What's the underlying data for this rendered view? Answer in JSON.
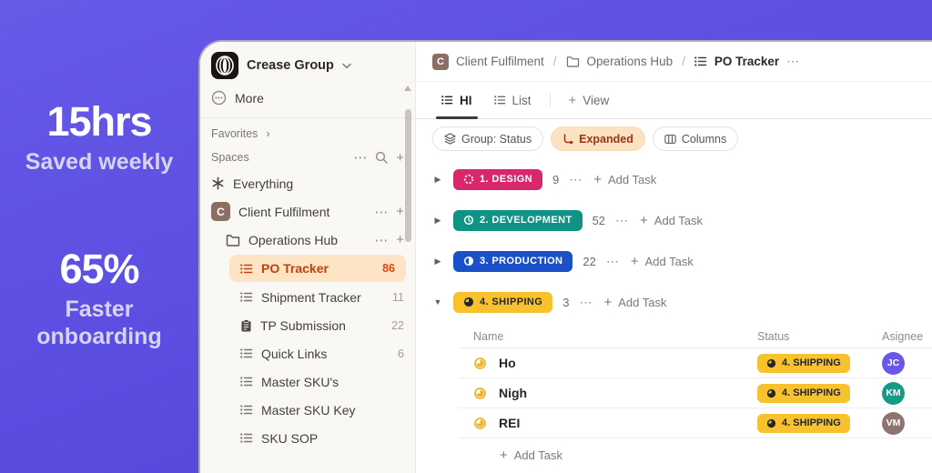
{
  "stats": [
    {
      "value": "15hrs",
      "label": "Saved weekly"
    },
    {
      "value": "65%",
      "label": "Faster onboarding"
    }
  ],
  "icons": {
    "ellipsis": "⋯",
    "plus": "+",
    "chevron_right": "›",
    "tri_right": "▶",
    "tri_down": "▼"
  },
  "sidebar": {
    "workspace_name": "Crease Group",
    "more_label": "More",
    "favorites_label": "Favorites",
    "spaces_label": "Spaces",
    "items": [
      {
        "label": "Everything"
      },
      {
        "label": "Client Fulfilment",
        "avatar_letter": "C",
        "avatar_color": "#8d6e63"
      },
      {
        "label": "Operations Hub"
      },
      {
        "label": "PO Tracker",
        "count": "86"
      },
      {
        "label": "Shipment Tracker",
        "count": "11"
      },
      {
        "label": "TP Submission",
        "count": "22"
      },
      {
        "label": "Quick Links",
        "count": "6"
      },
      {
        "label": "Master SKU's",
        "count": ""
      },
      {
        "label": "Master SKU Key",
        "count": ""
      },
      {
        "label": "SKU SOP",
        "count": ""
      }
    ]
  },
  "breadcrumb": {
    "space_letter": "C",
    "space_color": "#8d6e63",
    "space_label": "Client Fulfilment",
    "folder_label": "Operations Hub",
    "list_label": "PO Tracker"
  },
  "tabs": {
    "active_label": "HI",
    "list_label": "List",
    "add_view_label": "View"
  },
  "toolbar": {
    "group_label": "Group: Status",
    "expanded_label": "Expanded",
    "columns_label": "Columns"
  },
  "labels": {
    "add_task": "Add Task"
  },
  "groups": [
    {
      "name": "1. DESIGN",
      "count": "9",
      "color": "#d9276b",
      "text_color": "#ffffff"
    },
    {
      "name": "2. DEVELOPMENT",
      "count": "52",
      "color": "#0f9384",
      "text_color": "#ffffff"
    },
    {
      "name": "3. PRODUCTION",
      "count": "22",
      "color": "#1b51c8",
      "text_color": "#ffffff"
    },
    {
      "name": "4. SHIPPING",
      "count": "3",
      "color": "#f7c22d",
      "text_color": "#23262b"
    }
  ],
  "table": {
    "headers": [
      "Name",
      "Status",
      "Asignee"
    ],
    "status_accent": "#f0b429",
    "rows": [
      {
        "name": "Ho",
        "status": "4. SHIPPING",
        "status_color": "#f7c22d",
        "assignee_initials": "JC",
        "assignee_color": "#6957e8"
      },
      {
        "name": "Nigh",
        "status": "4. SHIPPING",
        "status_color": "#f7c22d",
        "assignee_initials": "KM",
        "assignee_color": "#169c86"
      },
      {
        "name": "REI",
        "status": "4. SHIPPING",
        "status_color": "#f7c22d",
        "assignee_initials": "VM",
        "assignee_color": "#8f7370"
      }
    ]
  }
}
